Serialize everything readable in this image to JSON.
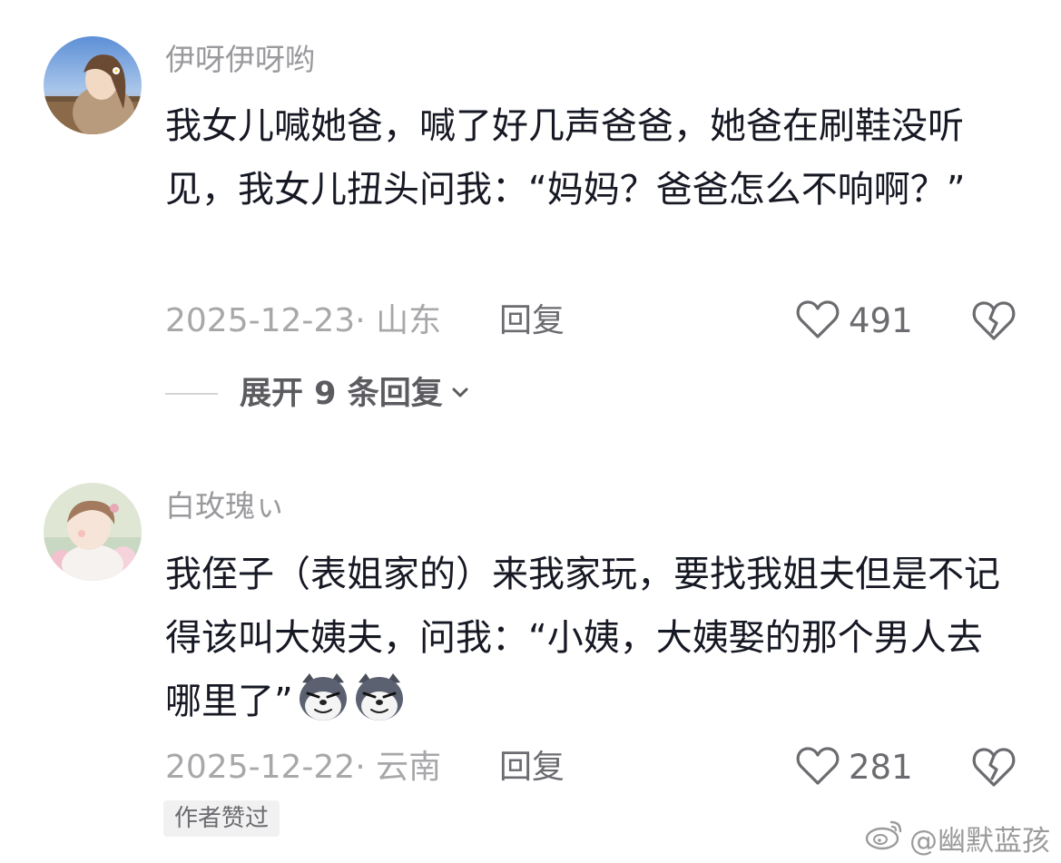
{
  "comments": [
    {
      "username": "伊呀伊呀哟",
      "text": "我女儿喊她爸，喊了好几声爸爸，她爸在刷鞋没听见，我女儿扭头问我：“妈妈？爸爸怎么不响啊？”",
      "date_location": "2025-12-23· 山东",
      "reply_label": "回复",
      "likes": "491",
      "avatar_icon": "avatar-photo-girl-outdoor"
    },
    {
      "username": "白玫瑰ぃ",
      "text": "我侄子（表姐家的）来我家玩，要找我姐夫但是不记得该叫大姨夫，问我：“小姨，大姨娶的那个男人去哪里了”",
      "date_location": "2025-12-22· 云南",
      "reply_label": "回复",
      "likes": "281",
      "avatar_icon": "avatar-photo-child-flowers",
      "emojis": [
        "smirk-dog-emoji",
        "smirk-dog-emoji"
      ],
      "badge": "作者赞过"
    }
  ],
  "expand_replies": {
    "label": "展开 9 条回复",
    "icon": "chevron-down-icon"
  },
  "watermark": {
    "text": "@幽默蓝孩",
    "icon": "weibo-logo-icon"
  },
  "colors": {
    "text_primary": "#161823",
    "text_secondary": "#9a9a9e",
    "meta": "#a8a8ab",
    "icon": "#6b6b70",
    "badge_bg": "#f1f1f2"
  }
}
